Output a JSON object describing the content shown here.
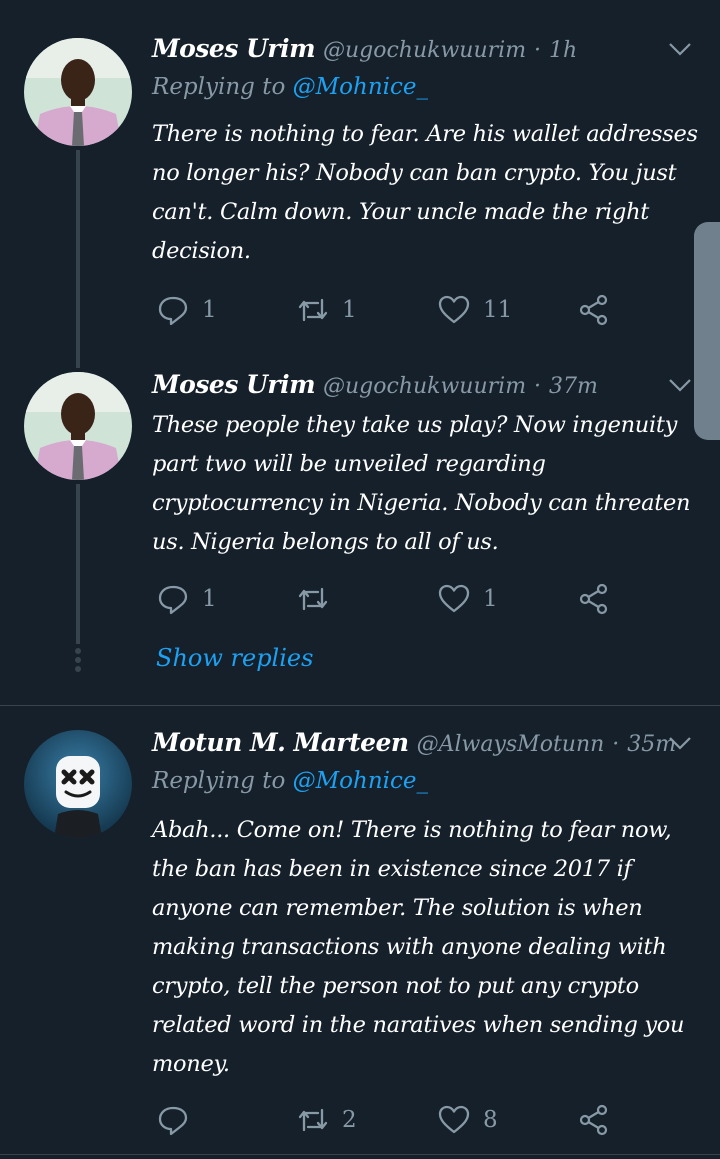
{
  "tweets": [
    {
      "name": "Moses Urim",
      "handle": "@ugochukwuurim",
      "dot": "·",
      "time": "1h",
      "replying_prefix": "Replying to",
      "replying_to": "@Mohnice_",
      "text": "There is nothing to fear. Are his wallet addresses no longer his? Nobody can ban crypto. You just can't. Calm down. Your uncle made the right decision.",
      "replies": "1",
      "retweets": "1",
      "likes": "11"
    },
    {
      "name": "Moses Urim",
      "handle": "@ugochukwuurim",
      "dot": "·",
      "time": "37m",
      "text": "These people they take us play? Now ingenuity part two will be unveiled regarding cryptocurrency in Nigeria. Nobody can threaten us. Nigeria belongs to all of us.",
      "replies": "1",
      "retweets": "",
      "likes": "1"
    },
    {
      "name": "Motun M. Marteen",
      "handle": "@AlwaysMotunn",
      "dot": "·",
      "time": "35m",
      "replying_prefix": "Replying to",
      "replying_to": "@Mohnice_",
      "text": "Abah... Come on! There is nothing to fear now, the ban has been in existence since 2017 if anyone can remember. The solution is when making transactions with anyone dealing with crypto, tell the person not to put any crypto related word in the naratives when sending you money.",
      "replies": "",
      "retweets": "2",
      "likes": "8"
    }
  ],
  "thread": {
    "show_replies": "Show replies"
  },
  "icons": {
    "reply": "reply-icon",
    "retweet": "retweet-icon",
    "like": "heart-icon",
    "share": "share-icon",
    "more": "chevron-down-icon"
  },
  "colors": {
    "background": "#15202b",
    "accent": "#1da1f2",
    "muted": "#8899a6",
    "divider": "#38444d"
  }
}
